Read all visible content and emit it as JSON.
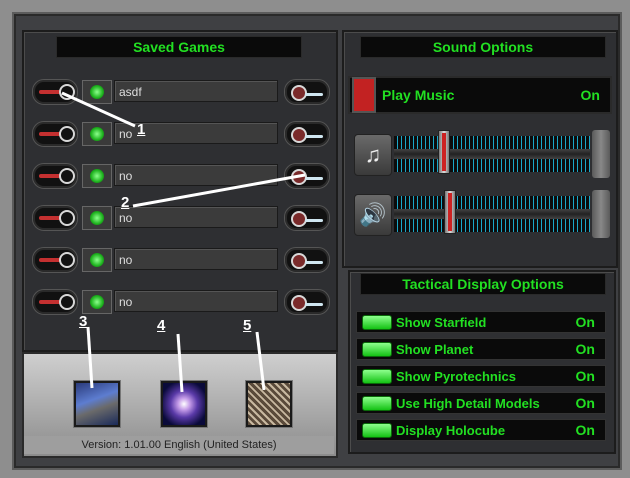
{
  "saved_games": {
    "title": "Saved Games",
    "slots": [
      {
        "name": "asdf"
      },
      {
        "name": "no"
      },
      {
        "name": "no"
      },
      {
        "name": "no"
      },
      {
        "name": "no"
      },
      {
        "name": "no"
      }
    ]
  },
  "annotations": [
    "1",
    "2",
    "3",
    "4",
    "5"
  ],
  "version": "Version: 1.01.00 English (United States)",
  "sound": {
    "title": "Sound Options",
    "play_music": {
      "label": "Play Music",
      "value": "On"
    },
    "music_volume": 0.25,
    "effects_volume": 0.28,
    "music_icon": "music-note-icon",
    "effects_icon": "speaker-icon"
  },
  "tactical": {
    "title": "Tactical Display Options",
    "options": [
      {
        "label": "Show Starfield",
        "value": "On"
      },
      {
        "label": "Show Planet",
        "value": "On"
      },
      {
        "label": "Show Pyrotechnics",
        "value": "On"
      },
      {
        "label": "Use High Detail Models",
        "value": "On"
      },
      {
        "label": "Display Holocube",
        "value": "On"
      }
    ]
  },
  "colors": {
    "text_green": "#22e022",
    "accent_red": "#c22222",
    "slider_cyan": "#1aa7c8"
  }
}
